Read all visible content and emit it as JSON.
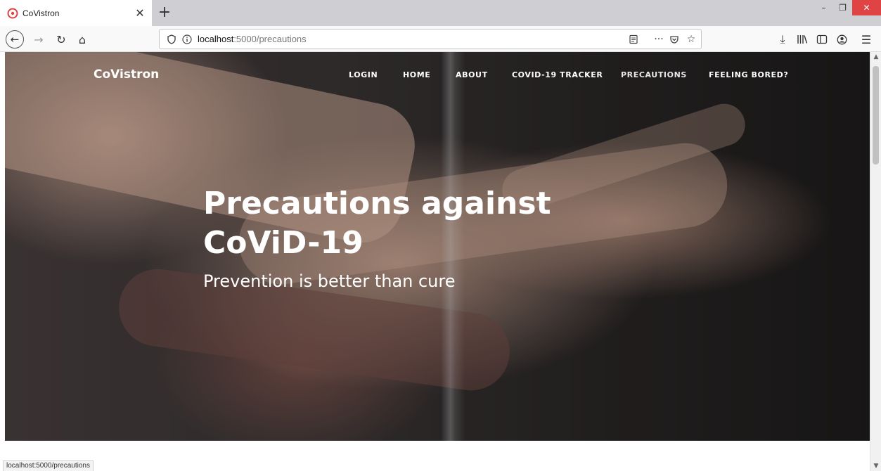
{
  "browser": {
    "tab_title": "CoVistron",
    "new_tab_label": "+",
    "url_host": "localhost",
    "url_path": ":5000/precautions",
    "status_url": "localhost:5000/precautions",
    "accent_color": "#e04343"
  },
  "site": {
    "brand": "CoVistron",
    "nav": [
      {
        "label": "LOGIN"
      },
      {
        "label": "HOME"
      },
      {
        "label": "ABOUT"
      },
      {
        "label": "COVID-19 TRACKER"
      },
      {
        "label": "PRECAUTIONS"
      },
      {
        "label": "FEELING BORED?"
      }
    ],
    "active_nav": "PRECAUTIONS"
  },
  "hero": {
    "title_line1": "Precautions against",
    "title_line2": "CoViD-19",
    "subtitle": "Prevention is better than cure"
  },
  "icons": [
    "back-icon",
    "forward-icon",
    "reload-icon",
    "home-icon",
    "shield-icon",
    "info-icon",
    "reader-view-icon",
    "more-actions-icon",
    "pocket-icon",
    "bookmark-star-icon",
    "download-icon",
    "library-icon",
    "sidebar-icon",
    "account-icon",
    "menu-icon"
  ]
}
